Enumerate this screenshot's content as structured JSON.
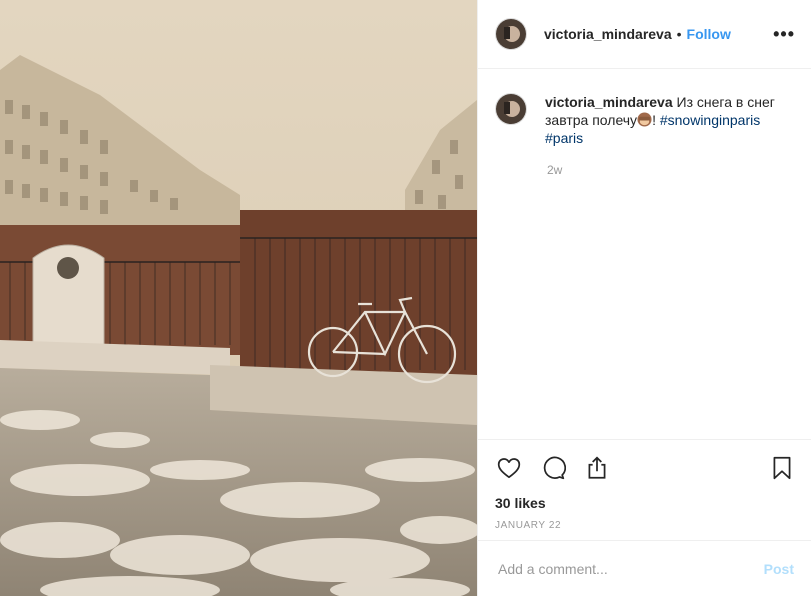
{
  "photo": {
    "alt": "Snowy Paris square with a bicycle leaning on a fence"
  },
  "header": {
    "username": "victoria_mindareva",
    "separator": "•",
    "follow_label": "Follow",
    "more_label": "•••"
  },
  "caption": {
    "username": "victoria_mindareva",
    "text_before_emoji": "Из снега в снег завтра полечу",
    "text_after_emoji": "!",
    "hashtags": [
      "#snowinginparis",
      "#paris"
    ],
    "time_ago": "2w"
  },
  "likes": "30 likes",
  "date": "JANUARY 22",
  "comment_box": {
    "placeholder": "Add a comment...",
    "post_label": "Post"
  },
  "colors": {
    "link": "#3897f0",
    "hashtag": "#003569",
    "muted": "#999999",
    "post_disabled": "#b2dffc"
  },
  "icons": [
    "heart-icon",
    "comment-icon",
    "share-icon",
    "bookmark-icon",
    "see-no-evil-monkey-emoji"
  ]
}
